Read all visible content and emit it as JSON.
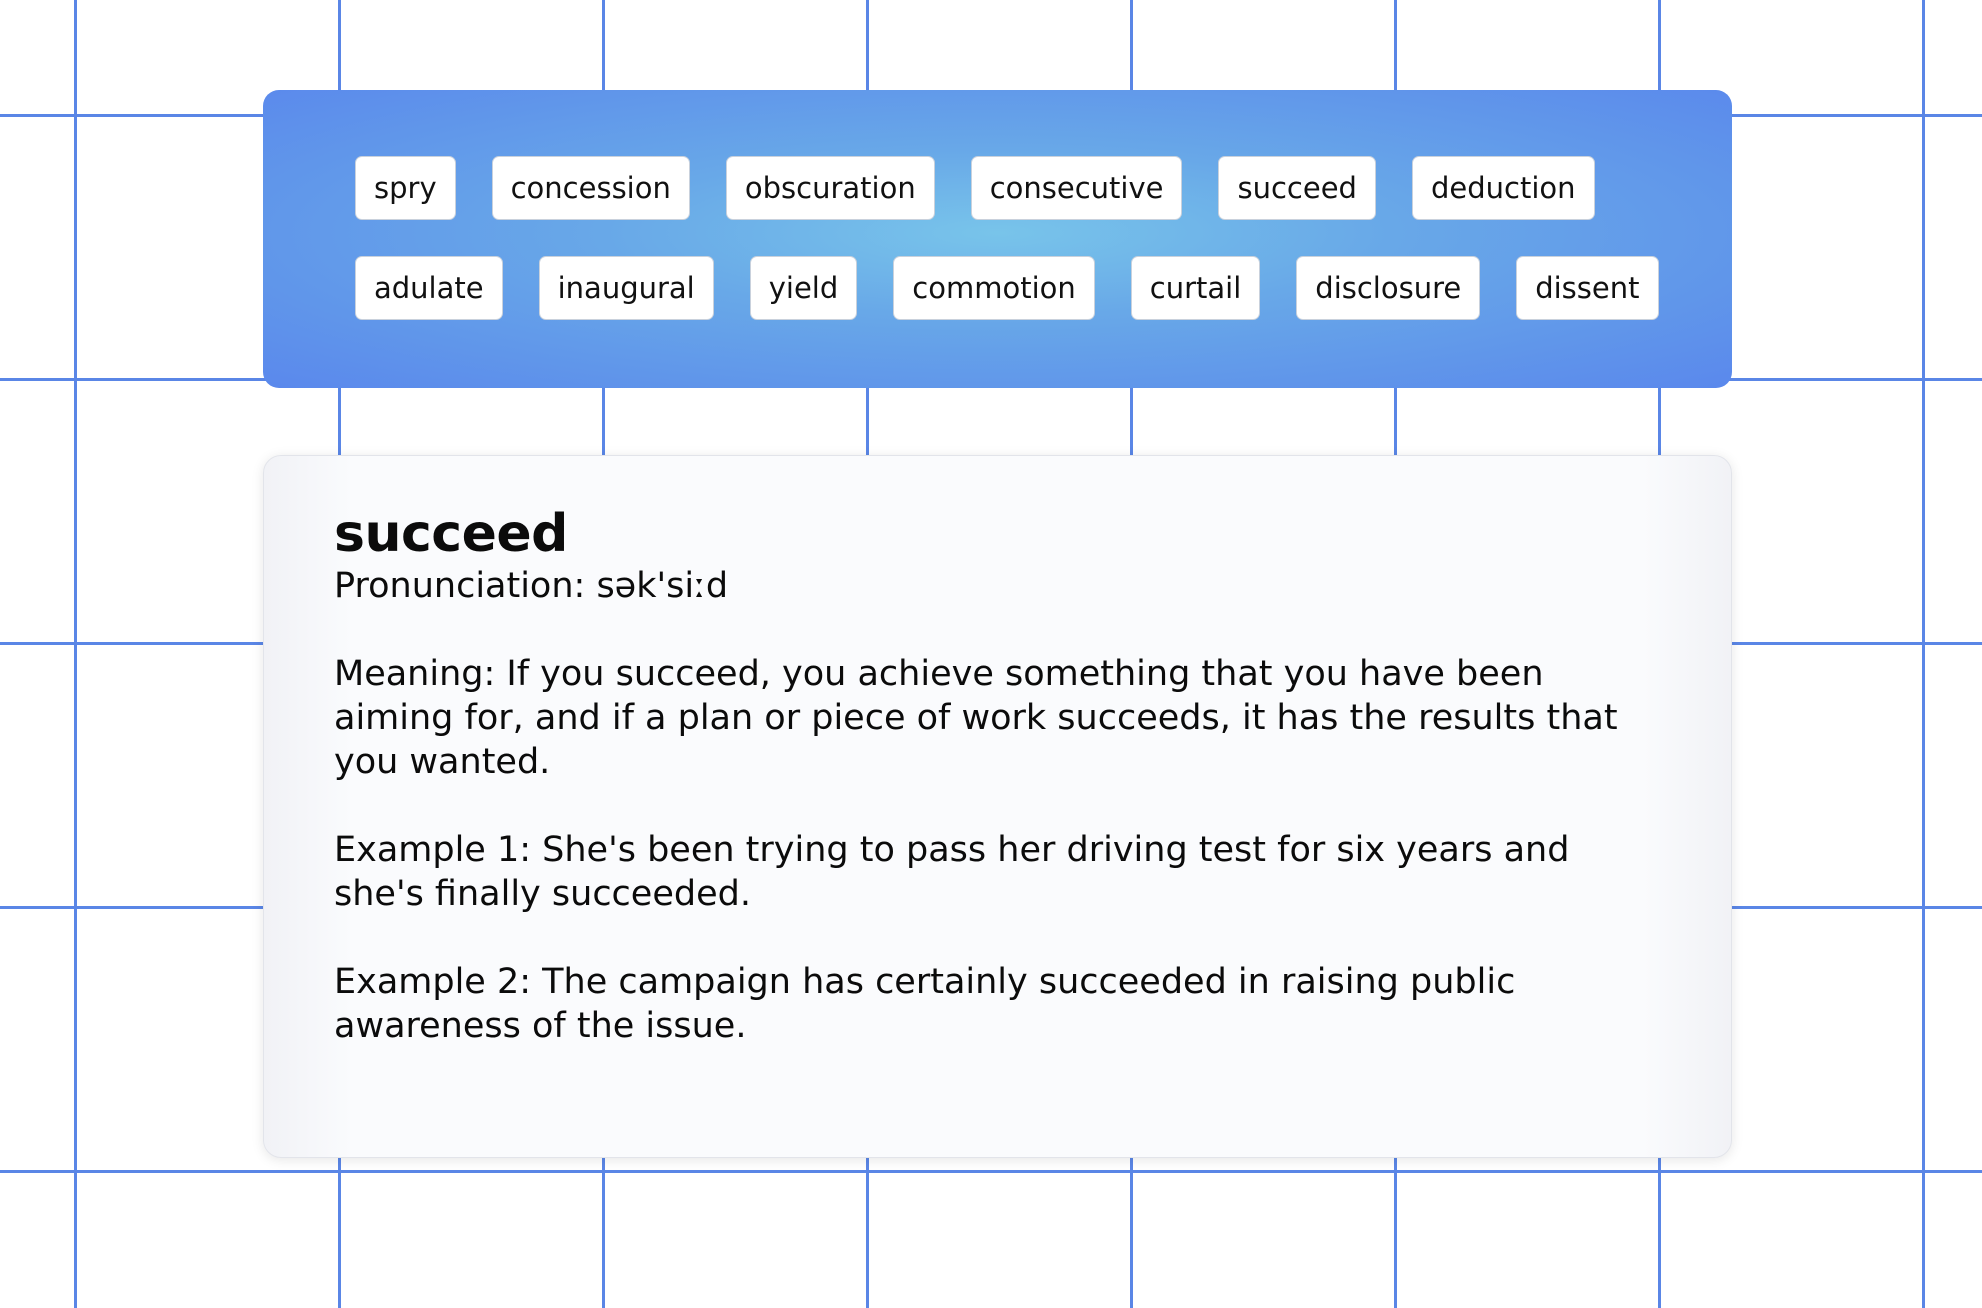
{
  "word_bank": {
    "row1": [
      "spry",
      "concession",
      "obscuration",
      "consecutive",
      "succeed",
      "deduction"
    ],
    "row2": [
      "adulate",
      "inaugural",
      "yield",
      "commotion",
      "curtail",
      "disclosure",
      "dissent"
    ]
  },
  "definition": {
    "word": "succeed",
    "pronunciation": "Pronunciation: sək'siːd",
    "meaning": "Meaning: If you succeed, you achieve something that you have been aiming for, and if a plan or piece of work succeeds, it has the results that you wanted.",
    "example1": "Example 1: She's been trying to pass her driving test for six years and she's finally succeeded.",
    "example2": "Example 2: The campaign has certainly succeeded in raising public awareness of the issue."
  },
  "colors": {
    "grid_line": "#5a86e6",
    "panel_edge": "#5a88ec",
    "panel_center": "#78c4ea"
  }
}
